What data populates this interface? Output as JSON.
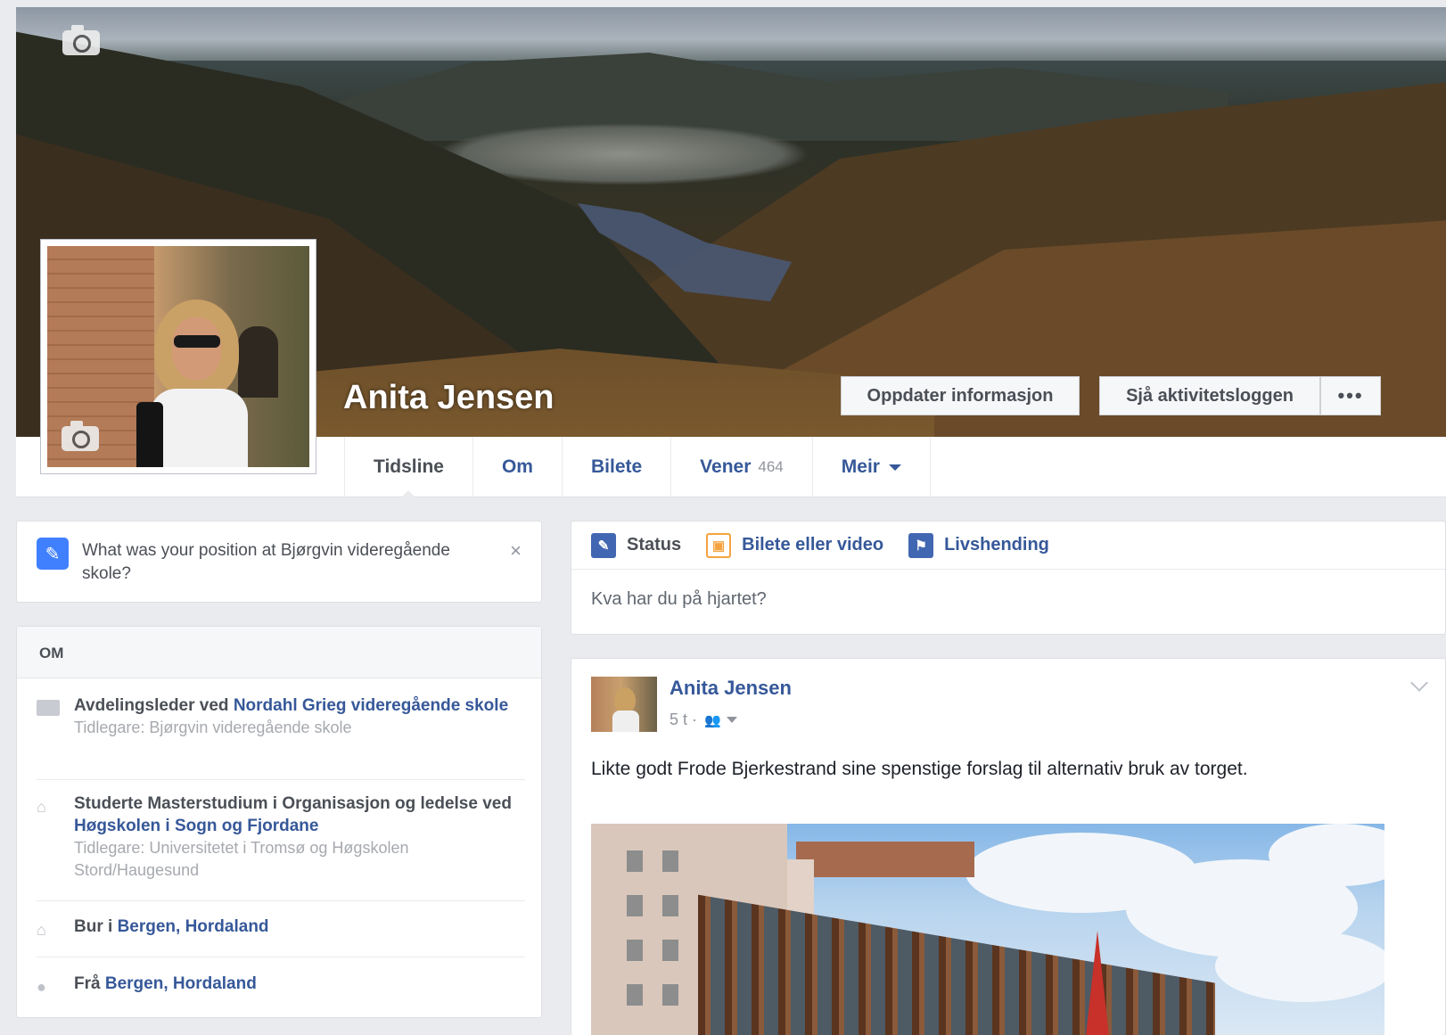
{
  "profile": {
    "name": "Anita Jensen"
  },
  "cover_buttons": {
    "update": "Oppdater informasjon",
    "activity_log": "Sjå aktivitetsloggen",
    "more": "•••"
  },
  "tabs": [
    {
      "label": "Tidsline"
    },
    {
      "label": "Om"
    },
    {
      "label": "Bilete"
    },
    {
      "label": "Vener",
      "count": "464"
    },
    {
      "label": "Meir"
    }
  ],
  "prompt": {
    "text": "What was your position at Bjørgvin videregående skole?",
    "close": "×"
  },
  "about": {
    "heading": "OM",
    "work": {
      "prefix": "Avdelingsleder ved ",
      "link": "Nordahl Grieg videregående skole",
      "previous": "Tidlegare: Bjørgvin videregående skole"
    },
    "education": {
      "prefix": "Studerte Masterstudium i Organisasjon og ledelse ved ",
      "link": "Høgskolen i Sogn og Fjordane",
      "previous": "Tidlegare: Universitetet i Tromsø og Høgskolen Stord/Haugesund"
    },
    "lives": {
      "prefix": "Bur i ",
      "link": "Bergen, Hordaland"
    },
    "from": {
      "prefix": "Frå ",
      "link": "Bergen, Hordaland"
    }
  },
  "composer": {
    "tabs": [
      {
        "label": "Status"
      },
      {
        "label": "Bilete eller video"
      },
      {
        "label": "Livshending"
      }
    ],
    "placeholder": "Kva har du på hjartet?"
  },
  "post": {
    "author": "Anita Jensen",
    "time": "5 t ·",
    "text": "Likte godt Frode Bjerkestrand sine spenstige forslag til alternativ bruk av torget."
  },
  "colors": {
    "link": "#365899",
    "background": "#e9ebee",
    "accent_blue": "#4080ff"
  },
  "icons": {
    "cover_camera": "camera-icon",
    "profile_camera": "camera-icon",
    "prompt": "pencil-icon",
    "work": "briefcase-icon",
    "education": "graduation-cap-icon",
    "lives": "home-icon",
    "from": "location-pin-icon",
    "audience": "friends-icon"
  }
}
